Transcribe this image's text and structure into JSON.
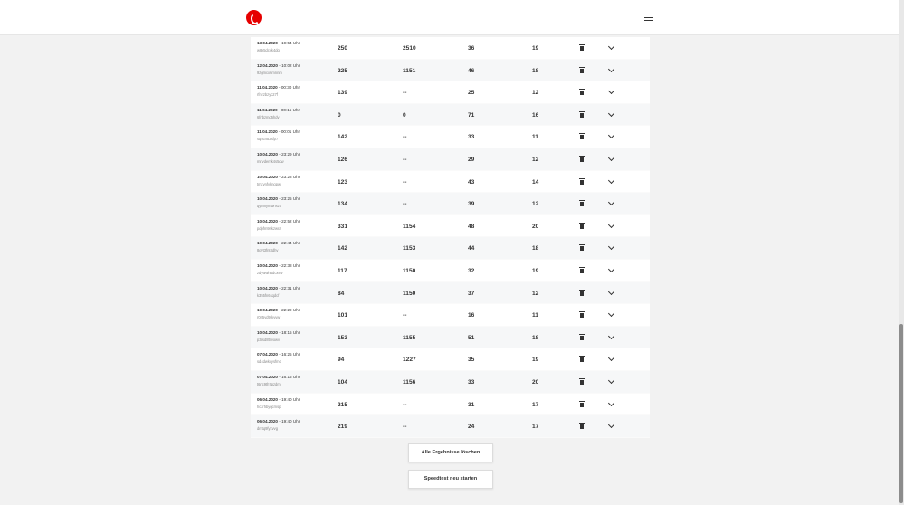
{
  "rows": [
    {
      "date": "13.04.2020",
      "time": "- 19:54 Uhr",
      "id": "w8k5dcyk4dg",
      "v1": "250",
      "v2": "2510",
      "v3": "36",
      "v4": "19"
    },
    {
      "date": "12.04.2020",
      "time": "- 10:02 Uhr",
      "id": "9zgmcx6mnnm",
      "v1": "225",
      "v2": "1151",
      "v3": "46",
      "v4": "18"
    },
    {
      "date": "11.04.2020",
      "time": "- 00:30 Uhr",
      "id": "rfnzzbzyc27f",
      "v1": "139",
      "v2": "--",
      "v3": "25",
      "v4": "12"
    },
    {
      "date": "11.04.2020",
      "time": "- 00:15 Uhr",
      "id": "6fnbzmd5hdv",
      "v1": "0",
      "v2": "0",
      "v3": "71",
      "v4": "16"
    },
    {
      "date": "11.04.2020",
      "time": "- 00:01 Uhr",
      "id": "sq5cn53sfp7",
      "v1": "142",
      "v2": "--",
      "v3": "33",
      "v4": "11"
    },
    {
      "date": "10.04.2020",
      "time": "- 23:29 Uhr",
      "id": "mnvdemk4s5qw",
      "v1": "126",
      "v2": "--",
      "v3": "29",
      "v4": "12"
    },
    {
      "date": "10.04.2020",
      "time": "- 23:28 Uhr",
      "id": "tmzvnfvkngpw",
      "v1": "123",
      "v2": "--",
      "v3": "43",
      "v4": "14"
    },
    {
      "date": "10.04.2020",
      "time": "- 23:25 Uhr",
      "id": "qymnymwnszc",
      "v1": "134",
      "v2": "--",
      "v3": "39",
      "v4": "12"
    },
    {
      "date": "10.04.2020",
      "time": "- 22:52 Uhr",
      "id": "pdpfm9nkzwra",
      "v1": "331",
      "v2": "1154",
      "v3": "48",
      "v4": "20"
    },
    {
      "date": "10.04.2020",
      "time": "- 22:44 Uhr",
      "id": "8gyt3fnt8dhv",
      "v1": "142",
      "v2": "1153",
      "v3": "44",
      "v4": "18"
    },
    {
      "date": "10.04.2020",
      "time": "- 22:38 Uhr",
      "id": "zdywwhrtdcxsw",
      "v1": "117",
      "v2": "1150",
      "v3": "32",
      "v4": "19"
    },
    {
      "date": "10.04.2020",
      "time": "- 22:31 Uhr",
      "id": "k355fn6sqdcf",
      "v1": "84",
      "v2": "1150",
      "v3": "37",
      "v4": "12"
    },
    {
      "date": "10.04.2020",
      "time": "- 22:29 Uhr",
      "id": "r0n5yd9rkyvw",
      "v1": "101",
      "v2": "--",
      "v3": "16",
      "v4": "11"
    },
    {
      "date": "10.04.2020",
      "time": "- 18:15 Uhr",
      "id": "p3rsd85wowv",
      "v1": "153",
      "v2": "1155",
      "v3": "51",
      "v4": "18"
    },
    {
      "date": "07.04.2020",
      "time": "- 16:25 Uhr",
      "id": "sd4dwkvysfmc",
      "v1": "94",
      "v2": "1227",
      "v3": "35",
      "v4": "19"
    },
    {
      "date": "07.04.2020",
      "time": "- 16:15 Uhr",
      "id": "t6nc9th7pzdm",
      "v1": "104",
      "v2": "1156",
      "v3": "33",
      "v4": "20"
    },
    {
      "date": "06.04.2020",
      "time": "- 19:40 Uhr",
      "id": "hczrhbyqcmsp",
      "v1": "215",
      "v2": "--",
      "v3": "31",
      "v4": "17"
    },
    {
      "date": "06.04.2020",
      "time": "- 19:40 Uhr",
      "id": "dmtq9fyxvvg",
      "v1": "219",
      "v2": "--",
      "v3": "24",
      "v4": "17"
    }
  ],
  "buttons": {
    "clear_all": "Alle Ergebnisse löschen",
    "restart": "Speedtest neu starten"
  },
  "icons": {
    "logo": "vodafone-logo-icon",
    "menu": "hamburger-menu-icon",
    "delete": "trash-icon",
    "expand": "chevron-down-icon"
  },
  "colors": {
    "brand": "#e60000"
  }
}
